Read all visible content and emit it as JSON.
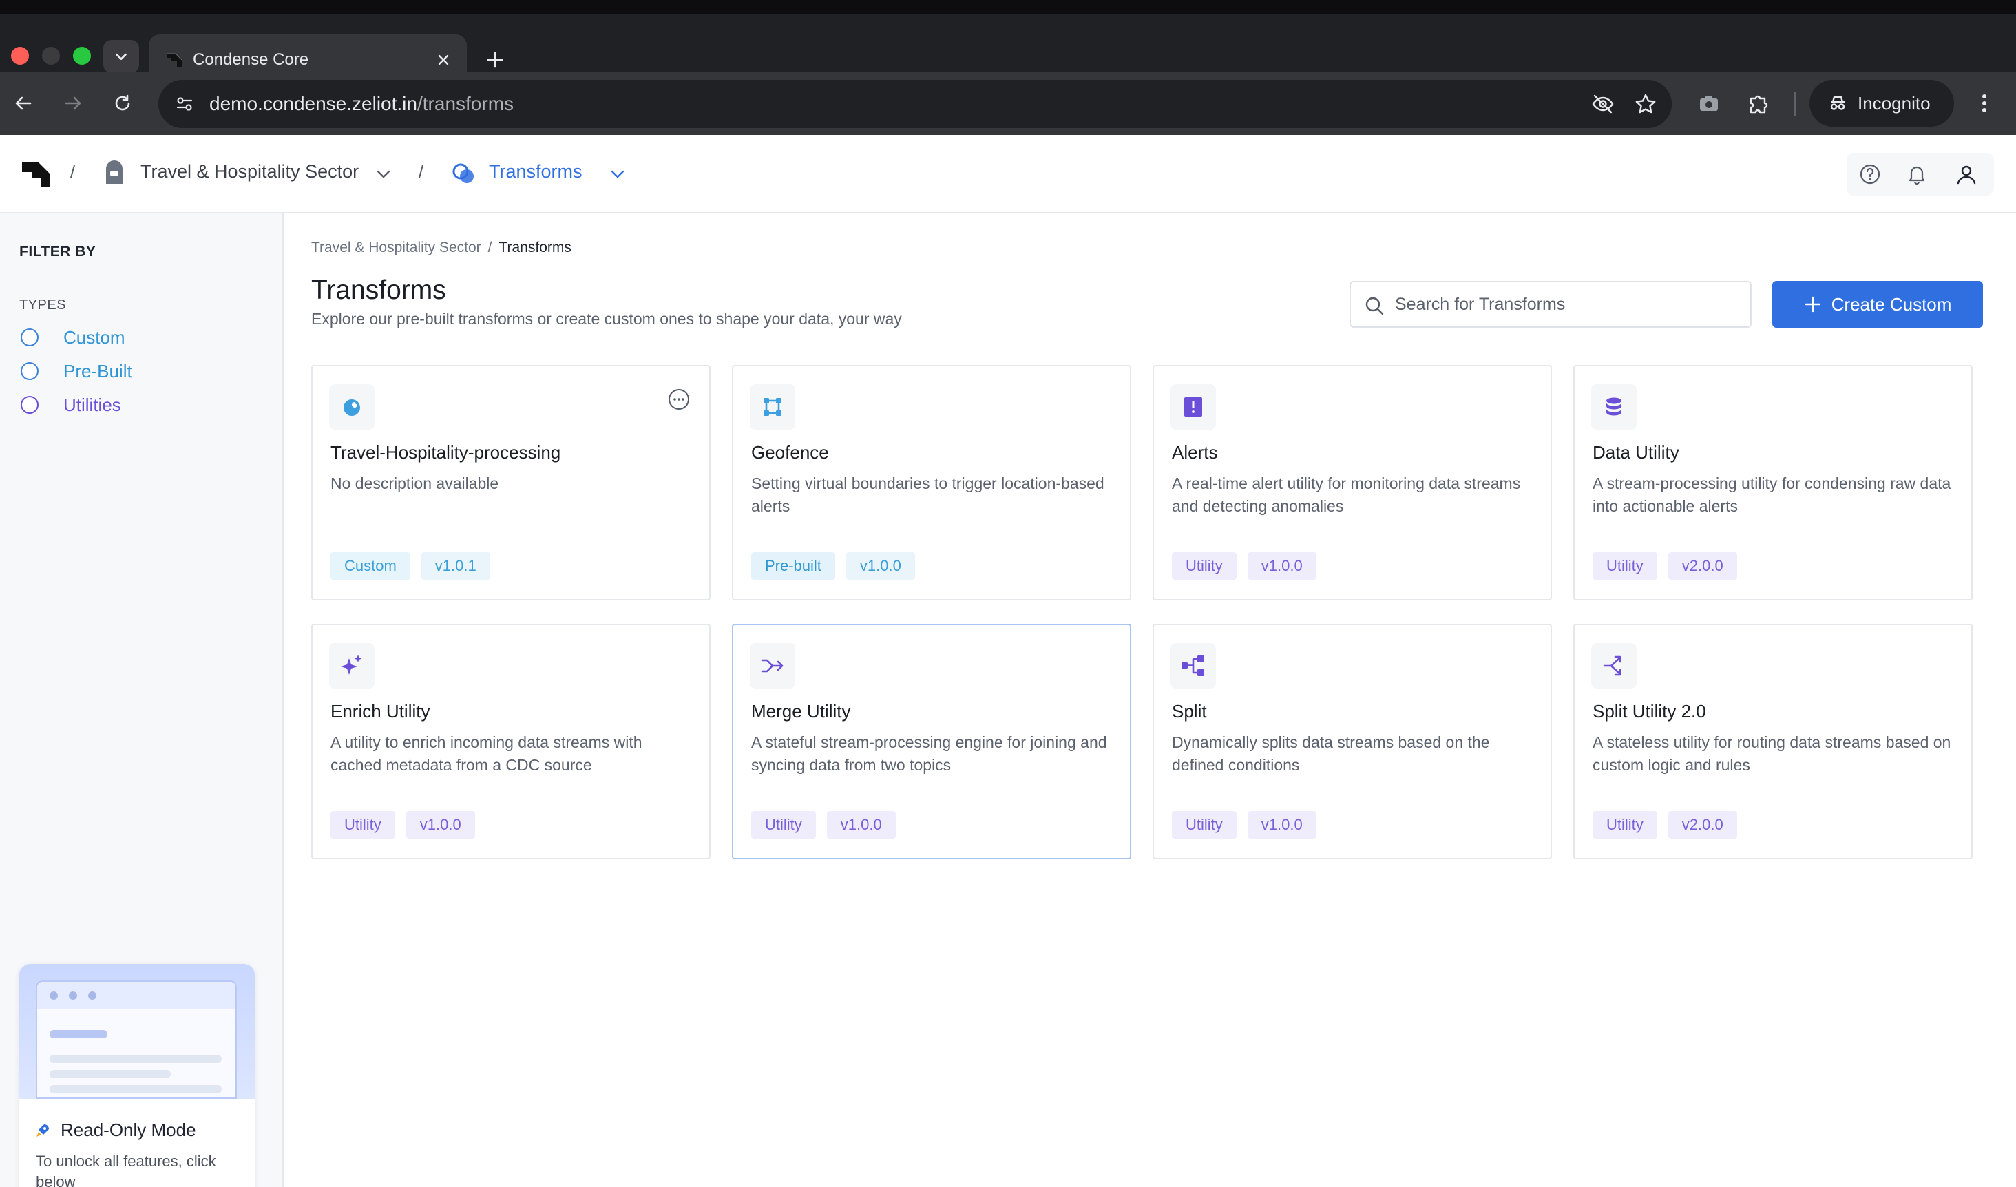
{
  "browser": {
    "tab_title": "Condense Core",
    "url_host": "demo.condense.zeliot.in",
    "url_path": "/transforms",
    "incognito_label": "Incognito"
  },
  "header": {
    "org_name": "Travel & Hospitality Sector",
    "section_name": "Transforms",
    "separator": "/"
  },
  "sidebar": {
    "filter_title": "FILTER BY",
    "types_title": "TYPES",
    "types": [
      {
        "label": "Custom",
        "color": "#2f95d6"
      },
      {
        "label": "Pre-Built",
        "color": "#2f95d6"
      },
      {
        "label": "Utilities",
        "color": "#6b4fd8"
      }
    ],
    "readonly": {
      "title": "Read-Only Mode",
      "description": "To unlock all features, click below"
    }
  },
  "main": {
    "breadcrumb": {
      "parent": "Travel & Hospitality Sector",
      "separator": "/",
      "current": "Transforms"
    },
    "title": "Transforms",
    "subtitle": "Explore our pre-built transforms or create custom ones to shape your data, your way",
    "search_placeholder": "Search for Transforms",
    "create_label": "Create Custom",
    "cards": [
      {
        "title": "Travel-Hospitality-processing",
        "description": "No description available",
        "type": "Custom",
        "version": "v1.0.1",
        "icon": "custom-transform-icon"
      },
      {
        "title": "Geofence",
        "description": "Setting virtual boundaries to trigger location-based alerts",
        "type": "Pre-built",
        "version": "v1.0.0",
        "icon": "geofence-icon"
      },
      {
        "title": "Alerts",
        "description": "A real-time alert utility for monitoring data streams and detecting anomalies",
        "type": "Utility",
        "version": "v1.0.0",
        "icon": "alert-icon"
      },
      {
        "title": "Data Utility",
        "description": "A stream-processing utility for condensing raw data into actionable alerts",
        "type": "Utility",
        "version": "v2.0.0",
        "icon": "database-icon"
      },
      {
        "title": "Enrich Utility",
        "description": "A utility to enrich incoming data streams with cached metadata from a CDC source",
        "type": "Utility",
        "version": "v1.0.0",
        "icon": "sparkle-icon"
      },
      {
        "title": "Merge Utility",
        "description": "A stateful stream-processing engine for joining and syncing data from two topics",
        "type": "Utility",
        "version": "v1.0.0",
        "icon": "merge-icon"
      },
      {
        "title": "Split",
        "description": "Dynamically splits data streams based on the defined conditions",
        "type": "Utility",
        "version": "v1.0.0",
        "icon": "split-icon"
      },
      {
        "title": "Split Utility 2.0",
        "description": "A stateless utility for routing data streams based on custom logic and rules",
        "type": "Utility",
        "version": "v2.0.0",
        "icon": "split-arrows-icon"
      }
    ]
  },
  "colors": {
    "accent": "#2f6fe0",
    "utility_purple": "#6b4fd8",
    "custom_blue": "#2f95d6"
  }
}
